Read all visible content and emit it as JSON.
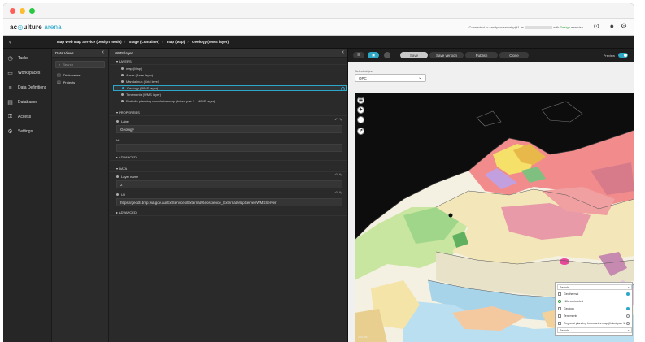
{
  "window": {
    "dots": [
      {
        "color": "#ff5f57"
      },
      {
        "color": "#febc2e"
      },
      {
        "color": "#28c840"
      }
    ]
  },
  "appbar": {
    "logo_ac": "ac",
    "logo_culture": "ulture",
    "logo_arena": "arena",
    "conn_prefix": "Connected to",
    "conn_user": "sandyconsecurity@1",
    "conn_as": "as",
    "conn_with": "with",
    "conn_status": "Design",
    "conn_suffix": "exercise",
    "icons": [
      "help-icon",
      "user-icon",
      "settings-icon"
    ]
  },
  "breadcrumb": {
    "items": [
      "Map Web Map Service (Design mode)",
      "Stage (Container)",
      "map (Map)",
      "Geology (WMS layer)"
    ]
  },
  "nav": {
    "items": [
      {
        "label": "Tasks",
        "icon": "clock-icon",
        "glyph": "◷"
      },
      {
        "label": "Workspaces",
        "icon": "monitor-icon",
        "glyph": "▭"
      },
      {
        "label": "Data Definitions",
        "icon": "database-definitions-icon",
        "glyph": "≡"
      },
      {
        "label": "Databases",
        "icon": "database-icon",
        "glyph": "▤"
      },
      {
        "label": "Access",
        "icon": "key-icon",
        "glyph": "⚿"
      },
      {
        "label": "Settings",
        "icon": "gear-icon",
        "glyph": "⚙"
      }
    ]
  },
  "data_views": {
    "title": "Data Views",
    "search_placeholder": "Search",
    "items": [
      "Dictionaries",
      "Projects"
    ]
  },
  "properties": {
    "title": "WMS layer",
    "layers_header": "LAYERS",
    "layers": [
      "map (Map)",
      "Areas (Base layer)",
      "Mandalinus (Grid level)",
      "Geology (WMS layer)",
      "Tenements (WMS layer)",
      "Portfolio planning cumulative map (linked pair 1 – WMS layer)"
    ],
    "selected_index": 3,
    "properties_header": "PROPERTIES",
    "label_title": "Label",
    "label_value": "Geology",
    "id_title": "Id",
    "id_value": "",
    "advanced_1": "ADVANCED",
    "data_header": "DATA",
    "layer_name_title": "Layer name",
    "layer_name_value": "2",
    "url_title": "Url",
    "url_value": "https://geodl.dmp.wa.gov.au/ExtServices/External/Geoscience_External/MapServer/WMSServer",
    "advanced_2": "ADVANCED"
  },
  "preview": {
    "tools": [
      "list-icon",
      "image-icon"
    ],
    "save": "Save",
    "save_version": "Save version",
    "publish": "Publish",
    "close": "Close",
    "preview_label": "Preview",
    "object_label": "Select object",
    "object_value": "OPC",
    "map_controls": [
      "layers-icon",
      "zoom-in-icon",
      "zoom-out-icon",
      "compass-icon"
    ],
    "legend": {
      "top": "Search",
      "rows": [
        {
          "label": "Geothermal",
          "on": true
        },
        {
          "label": "Hills contracted",
          "on": true
        },
        {
          "label": "Geology",
          "on": true
        },
        {
          "label": "Tenements",
          "on": false
        },
        {
          "label": "Regional planning boundaries map (linked pair 1)",
          "on": false
        }
      ],
      "bottom": "Search"
    },
    "scale": "200 km"
  }
}
